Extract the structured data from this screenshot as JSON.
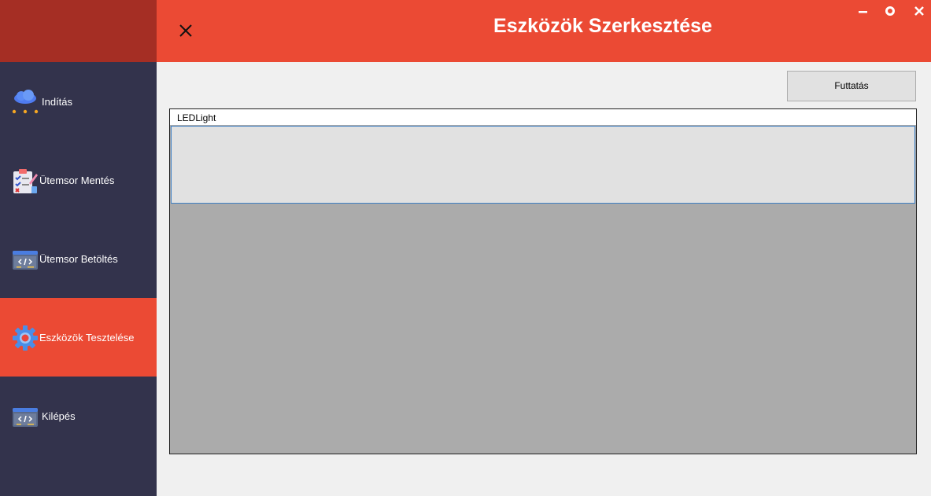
{
  "header": {
    "title": "Eszközök Szerkesztése"
  },
  "sidebar": {
    "items": [
      {
        "label": "Indítás",
        "icon": "cloud-icon",
        "active": false
      },
      {
        "label": "Ütemsor Mentés",
        "icon": "clipboard-checklist-icon",
        "active": false
      },
      {
        "label": "Ütemsor Betöltés",
        "icon": "code-window-icon",
        "active": false
      },
      {
        "label": "Eszközök Tesztelése",
        "icon": "gear-icon",
        "active": true
      },
      {
        "label": "Kilépés",
        "icon": "code-window-icon",
        "active": false
      }
    ]
  },
  "toolbar": {
    "run_label": "Futtatás"
  },
  "panel": {
    "tab_label": "LEDLight"
  },
  "colors": {
    "accent": "#eb4a34",
    "sidebar_bg": "#33334c",
    "logo_bg": "#a52e24",
    "content_bg": "#f0f0f0"
  }
}
